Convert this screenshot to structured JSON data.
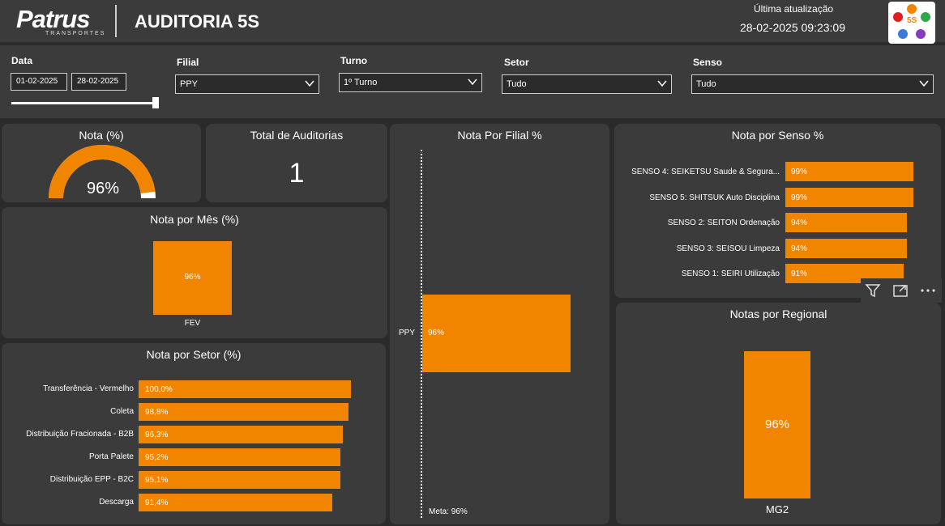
{
  "header": {
    "logo_text": "Patrus",
    "logo_sub": "TRANSPORTES",
    "title": "AUDITORIA 5S",
    "update_label": "Última atualização",
    "update_value": "28-02-2025 09:23:09",
    "badge_text": "5S"
  },
  "filters": {
    "data_label": "Data",
    "date_start": "01-02-2025",
    "date_end": "28-02-2025",
    "date_range_fill": 1.0,
    "filial_label": "Filial",
    "filial_value": "PPY",
    "turno_label": "Turno",
    "turno_value": "1º Turno",
    "setor_label": "Setor",
    "setor_value": "Tudo",
    "senso_label": "Senso",
    "senso_value": "Tudo"
  },
  "nota_card": {
    "title": "Nota (%)",
    "value_label": "96%",
    "value": 96
  },
  "total_card": {
    "title": "Total de Auditorias",
    "value": "1"
  },
  "mes_card": {
    "title": "Nota por Mês (%)"
  },
  "setor_card": {
    "title": "Nota por Setor (%)"
  },
  "filial_card": {
    "title": "Nota Por Filial %",
    "meta_label": "Meta: 96%"
  },
  "senso_card": {
    "title": "Nota por Senso %"
  },
  "regional_card": {
    "title": "Notas por Regional"
  },
  "colors": {
    "accent": "#f28500",
    "panel": "#3b3b3b",
    "background": "#2b2b2b"
  },
  "chart_data": [
    {
      "type": "gauge",
      "title": "Nota (%)",
      "value": 96,
      "ylim": [
        0,
        100
      ]
    },
    {
      "type": "bar",
      "title": "Nota por Mês (%)",
      "categories": [
        "FEV"
      ],
      "values": [
        96
      ],
      "data_labels": [
        "96%"
      ]
    },
    {
      "type": "bar",
      "orientation": "horizontal",
      "title": "Nota por Setor (%)",
      "categories": [
        "Transferência - Vermelho",
        "Coleta",
        "Distribuição Fracionada - B2B",
        "Porta Palete",
        "Distribuição EPP - B2C",
        "Descarga"
      ],
      "values": [
        100.0,
        98.8,
        96.3,
        95.2,
        95.1,
        91.4
      ],
      "data_labels": [
        "100,0%",
        "98,8%",
        "96,3%",
        "95,2%",
        "95,1%",
        "91,4%"
      ]
    },
    {
      "type": "bar",
      "orientation": "horizontal",
      "title": "Nota Por Filial %",
      "categories": [
        "PPY"
      ],
      "values": [
        96
      ],
      "data_labels": [
        "96%"
      ],
      "reference_line": {
        "label": "Meta: 96%",
        "value": 96
      }
    },
    {
      "type": "bar",
      "orientation": "horizontal",
      "title": "Nota por Senso %",
      "categories": [
        "SENSO 4: SEIKETSU Saude & Segura...",
        "SENSO 5: SHITSUK Auto Disciplina",
        "SENSO 2: SEITON Ordenação",
        "SENSO 3: SEISOU Limpeza",
        "SENSO 1: SEIRI Utilização"
      ],
      "values": [
        99,
        99,
        94,
        94,
        91
      ],
      "data_labels": [
        "99%",
        "99%",
        "94%",
        "94%",
        "91%"
      ]
    },
    {
      "type": "bar",
      "title": "Notas por Regional",
      "categories": [
        "MG2"
      ],
      "values": [
        96
      ],
      "data_labels": [
        "96%"
      ]
    }
  ]
}
